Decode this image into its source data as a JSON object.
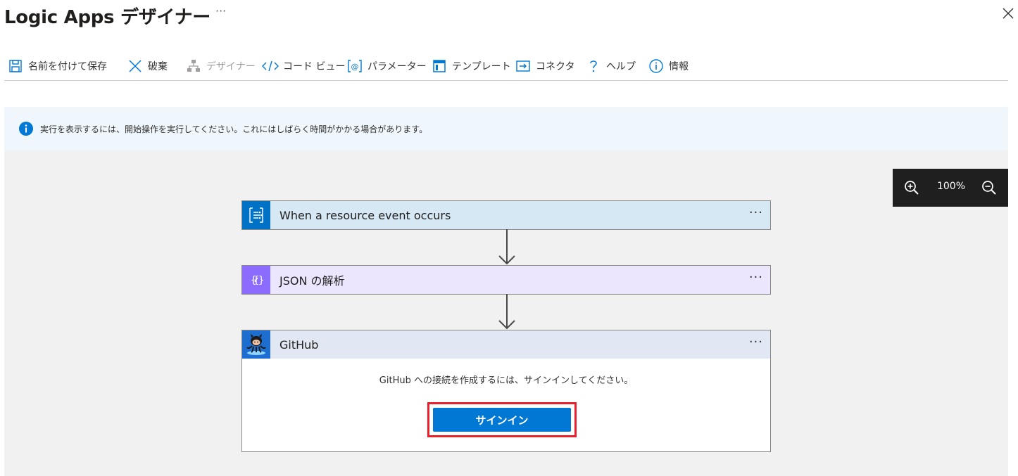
{
  "window": {
    "title": "Logic Apps デザイナー",
    "more": "···"
  },
  "toolbar": {
    "items": [
      {
        "label": "名前を付けて保存",
        "icon": "save-icon",
        "enabled": true
      },
      {
        "label": "破棄",
        "icon": "discard-icon",
        "enabled": true
      },
      {
        "label": "デザイナー",
        "icon": "designer-icon",
        "enabled": false
      },
      {
        "label": "コード ビュー",
        "icon": "code-view-icon",
        "enabled": true
      },
      {
        "label": "パラメーター",
        "icon": "parameters-icon",
        "enabled": true
      },
      {
        "label": "テンプレート",
        "icon": "templates-icon",
        "enabled": true
      },
      {
        "label": "コネクタ",
        "icon": "connectors-icon",
        "enabled": true
      },
      {
        "label": "ヘルプ",
        "icon": "help-icon",
        "enabled": true
      },
      {
        "label": "情報",
        "icon": "info-icon",
        "enabled": true
      }
    ]
  },
  "banner": {
    "text": "実行を表示するには、開始操作を実行してください。これにはしばらく時間がかかる場合があります。",
    "icon": "info-circle-icon"
  },
  "zoom": {
    "level": "100%"
  },
  "steps": [
    {
      "title": "When a resource event occurs",
      "icon": "event-grid-icon",
      "color": "#0072c6",
      "header_bg": "#d7e8f5"
    },
    {
      "title": "JSON の解析",
      "icon": "json-parse-icon",
      "color": "#8c6cff",
      "header_bg": "#ebe6fd"
    },
    {
      "title": "GitHub",
      "icon": "github-octocat-icon",
      "color": "#1e6ed0",
      "header_bg": "#e1e8f3"
    }
  ],
  "github": {
    "message": "GitHub への接続を作成するには、サインインしてください。",
    "signin_label": "サインイン"
  },
  "colors": {
    "accent": "#0078d4",
    "highlight": "#e8202a"
  }
}
